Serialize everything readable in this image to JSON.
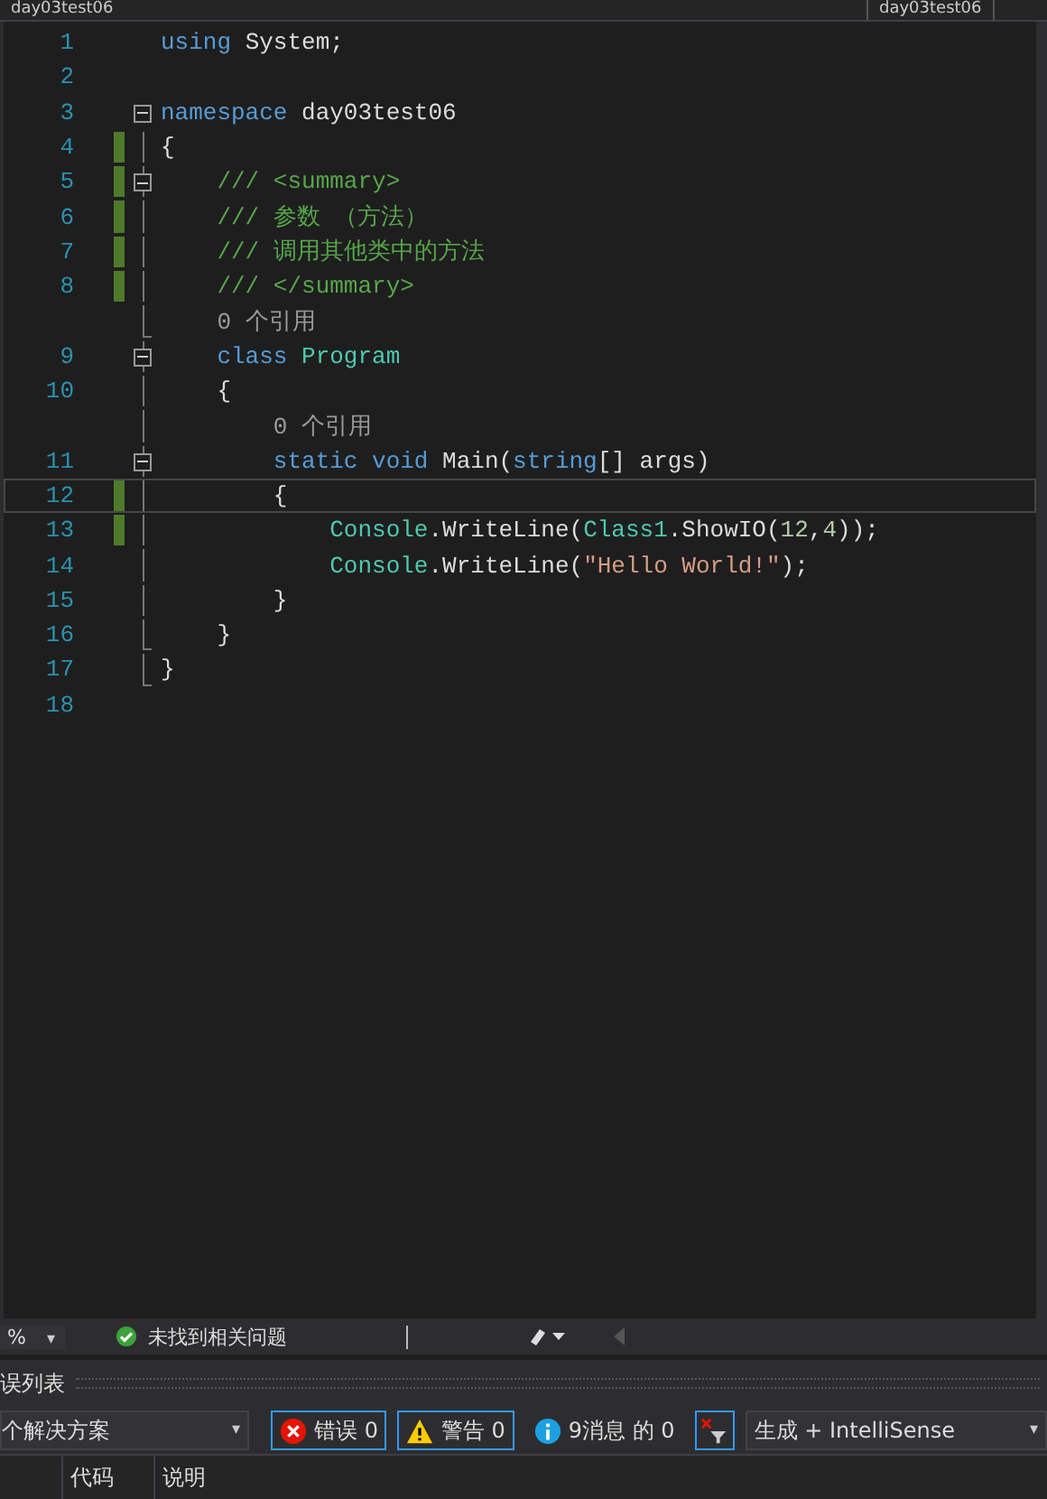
{
  "top_bar": {
    "left_combo": "day03test06",
    "right_combo": "day03test06"
  },
  "editor": {
    "lines": [
      {
        "number": "1",
        "changed": false,
        "collapsible": false,
        "in_block": false,
        "block_end": false,
        "tokens": [
          {
            "kind": "keyword",
            "text": "using"
          },
          {
            "kind": "plain",
            "text": " System;"
          }
        ]
      },
      {
        "number": "2",
        "changed": false,
        "collapsible": false,
        "in_block": false,
        "block_end": false
      },
      {
        "number": "3",
        "changed": false,
        "collapsible": true,
        "in_block": false,
        "block_end": false,
        "tokens": [
          {
            "kind": "keyword",
            "text": "namespace"
          },
          {
            "kind": "plain",
            "text": " day03test06"
          }
        ]
      },
      {
        "number": "4",
        "changed": true,
        "collapsible": false,
        "in_block": true,
        "block_end": false,
        "tokens": [
          {
            "kind": "plain",
            "text": "{"
          }
        ]
      },
      {
        "number": "5",
        "changed": true,
        "collapsible": true,
        "in_block": true,
        "block_end": false,
        "tokens": [
          {
            "kind": "comment",
            "text": "    /// <summary>"
          }
        ]
      },
      {
        "number": "6",
        "changed": true,
        "collapsible": false,
        "in_block": true,
        "block_end": false,
        "tokens": [
          {
            "kind": "comment",
            "text": "    /// 参数 （方法）"
          }
        ]
      },
      {
        "number": "7",
        "changed": true,
        "collapsible": false,
        "in_block": true,
        "block_end": false,
        "tokens": [
          {
            "kind": "comment",
            "text": "    /// 调用其他类中的方法"
          }
        ]
      },
      {
        "number": "8",
        "changed": true,
        "collapsible": false,
        "in_block": true,
        "block_end": false,
        "tokens": [
          {
            "kind": "comment",
            "text": "    /// </summary>"
          }
        ]
      },
      {
        "changed": false,
        "collapsible": false,
        "in_block": true,
        "block_end": true,
        "tokens": [
          {
            "kind": "lens",
            "text": "    0 个引用"
          }
        ]
      },
      {
        "number": "9",
        "changed": false,
        "collapsible": true,
        "in_block": true,
        "block_end": false,
        "tokens": [
          {
            "kind": "keyword",
            "text": "    class"
          },
          {
            "kind": "type",
            "text": " Program"
          }
        ]
      },
      {
        "number": "10",
        "changed": false,
        "collapsible": false,
        "in_block": true,
        "block_end": false,
        "tokens": [
          {
            "kind": "plain",
            "text": "    {"
          }
        ]
      },
      {
        "changed": false,
        "collapsible": false,
        "in_block": true,
        "block_end": false,
        "tokens": [
          {
            "kind": "lens",
            "text": "        0 个引用"
          }
        ]
      },
      {
        "number": "11",
        "changed": false,
        "collapsible": true,
        "in_block": true,
        "block_end": false,
        "tokens": [
          {
            "kind": "keyword",
            "text": "        static void"
          },
          {
            "kind": "plain",
            "text": " Main("
          },
          {
            "kind": "keyword",
            "text": "string"
          },
          {
            "kind": "plain",
            "text": "[] args)"
          }
        ]
      },
      {
        "number": "12",
        "changed": true,
        "collapsible": false,
        "in_block": true,
        "block_end": false,
        "current": true,
        "tokens": [
          {
            "kind": "plain",
            "text": "        {"
          }
        ]
      },
      {
        "number": "13",
        "changed": true,
        "collapsible": false,
        "in_block": true,
        "block_end": false,
        "tokens": [
          {
            "kind": "type",
            "text": "            Console"
          },
          {
            "kind": "plain",
            "text": ".WriteLine("
          },
          {
            "kind": "type",
            "text": "Class1"
          },
          {
            "kind": "plain",
            "text": ".ShowIO("
          },
          {
            "kind": "number",
            "text": "12"
          },
          {
            "kind": "plain",
            "text": ","
          },
          {
            "kind": "number",
            "text": "4"
          },
          {
            "kind": "plain",
            "text": "));"
          }
        ]
      },
      {
        "number": "14",
        "changed": false,
        "collapsible": false,
        "in_block": true,
        "block_end": false,
        "tokens": [
          {
            "kind": "type",
            "text": "            Console"
          },
          {
            "kind": "plain",
            "text": ".WriteLine("
          },
          {
            "kind": "string",
            "text": "\"Hello World!\""
          },
          {
            "kind": "plain",
            "text": ");"
          }
        ]
      },
      {
        "number": "15",
        "changed": false,
        "collapsible": false,
        "in_block": true,
        "block_end": false,
        "tokens": [
          {
            "kind": "plain",
            "text": "        }"
          }
        ]
      },
      {
        "number": "16",
        "changed": false,
        "collapsible": false,
        "in_block": true,
        "block_end": true,
        "tokens": [
          {
            "kind": "plain",
            "text": "    }"
          }
        ]
      },
      {
        "number": "17",
        "changed": false,
        "collapsible": false,
        "in_block": true,
        "block_end": true,
        "tokens": [
          {
            "kind": "plain",
            "text": "}"
          }
        ]
      },
      {
        "number": "18",
        "changed": false,
        "collapsible": false,
        "in_block": false,
        "block_end": false
      }
    ]
  },
  "status_bar": {
    "zoom": "%",
    "zoom_caret": "▾",
    "issues": "未找到相关问题"
  },
  "error_list": {
    "title": "误列表",
    "scope": "个解决方案",
    "scope_caret": "▾",
    "source_caret": "▾",
    "filters": [
      {
        "kind": "error",
        "label": "错误 0",
        "selected": true
      },
      {
        "kind": "warning",
        "label": "警告 0",
        "selected": true
      },
      {
        "kind": "info",
        "label": "9消息 的 0",
        "selected": false
      }
    ],
    "source": "生成 + IntelliSense",
    "columns": [
      "代码",
      "说明"
    ]
  }
}
